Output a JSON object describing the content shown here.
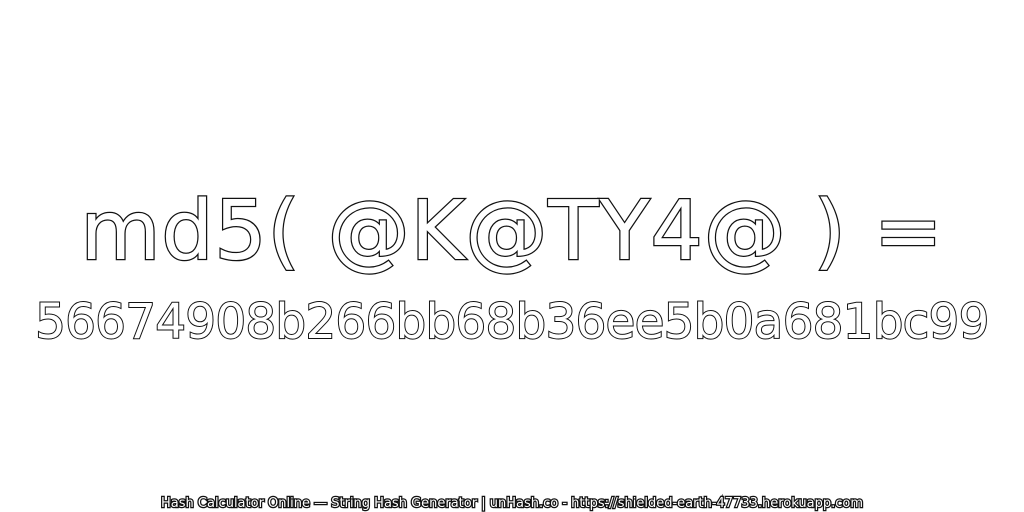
{
  "expression": "md5( @K@TY4@ ) =",
  "hash": "56674908b266bb68b36ee5b0a681bc99",
  "footer": "Hash Calculator Online — String Hash Generator | unHash.co - https://shielded-earth-47733.herokuapp.com"
}
